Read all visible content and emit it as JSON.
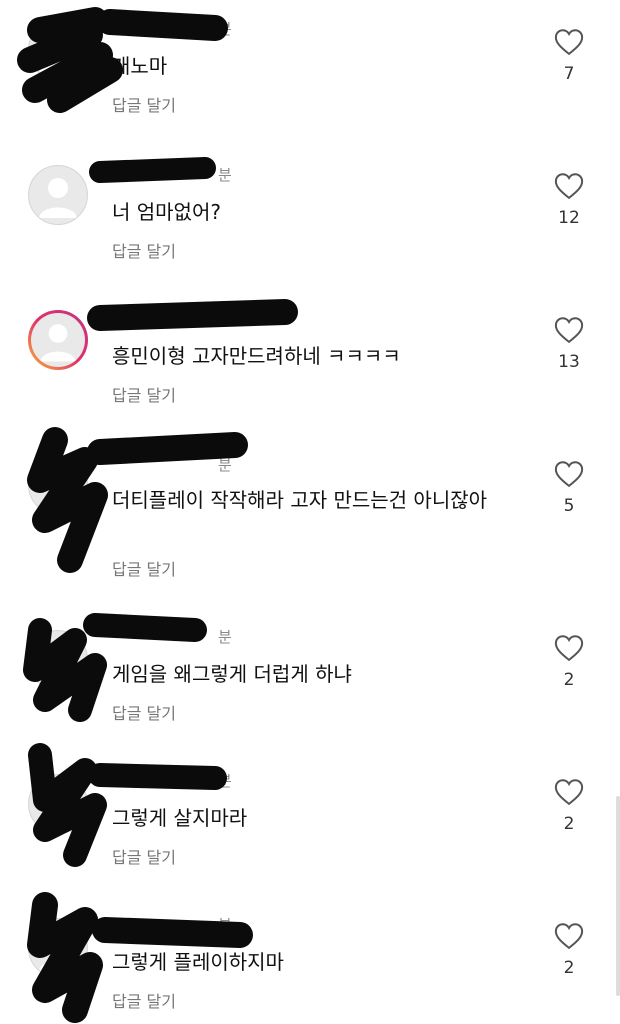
{
  "comments": [
    {
      "username": "",
      "time": "분",
      "text": "개노마",
      "reply_label": "답글 달기",
      "likes": "7",
      "story_ring": false
    },
    {
      "username": "",
      "time": "분",
      "text": "너 엄마없어?",
      "reply_label": "답글 달기",
      "likes": "12",
      "story_ring": false
    },
    {
      "username": "",
      "time": "",
      "text": "흥민이형 고자만드려하네 ㅋㅋㅋㅋ",
      "reply_label": "답글 달기",
      "likes": "13",
      "story_ring": true
    },
    {
      "username": "",
      "time": "분",
      "text": "더티플레이 작작해라 고자 만드는건 아니잖아",
      "reply_label": "답글 달기",
      "likes": "5",
      "story_ring": false
    },
    {
      "username": "",
      "time": "분",
      "text": "게임을 왜그렇게 더럽게 하냐",
      "reply_label": "답글 달기",
      "likes": "2",
      "story_ring": false
    },
    {
      "username": "",
      "time": "분",
      "text": "그렇게 살지마라",
      "reply_label": "답글 달기",
      "likes": "2",
      "story_ring": false
    },
    {
      "username": "",
      "time": "분",
      "text": "그렇게 플레이하지마",
      "reply_label": "답글 달기",
      "likes": "2",
      "story_ring": false
    }
  ],
  "icons": {
    "like": "heart-outline-icon",
    "avatar": "default-avatar-icon"
  },
  "colors": {
    "text": "#111111",
    "meta": "#777777",
    "redaction": "#0b0b0b",
    "story_gradient": [
      "#f7b43a",
      "#e1306c",
      "#c13584"
    ]
  }
}
